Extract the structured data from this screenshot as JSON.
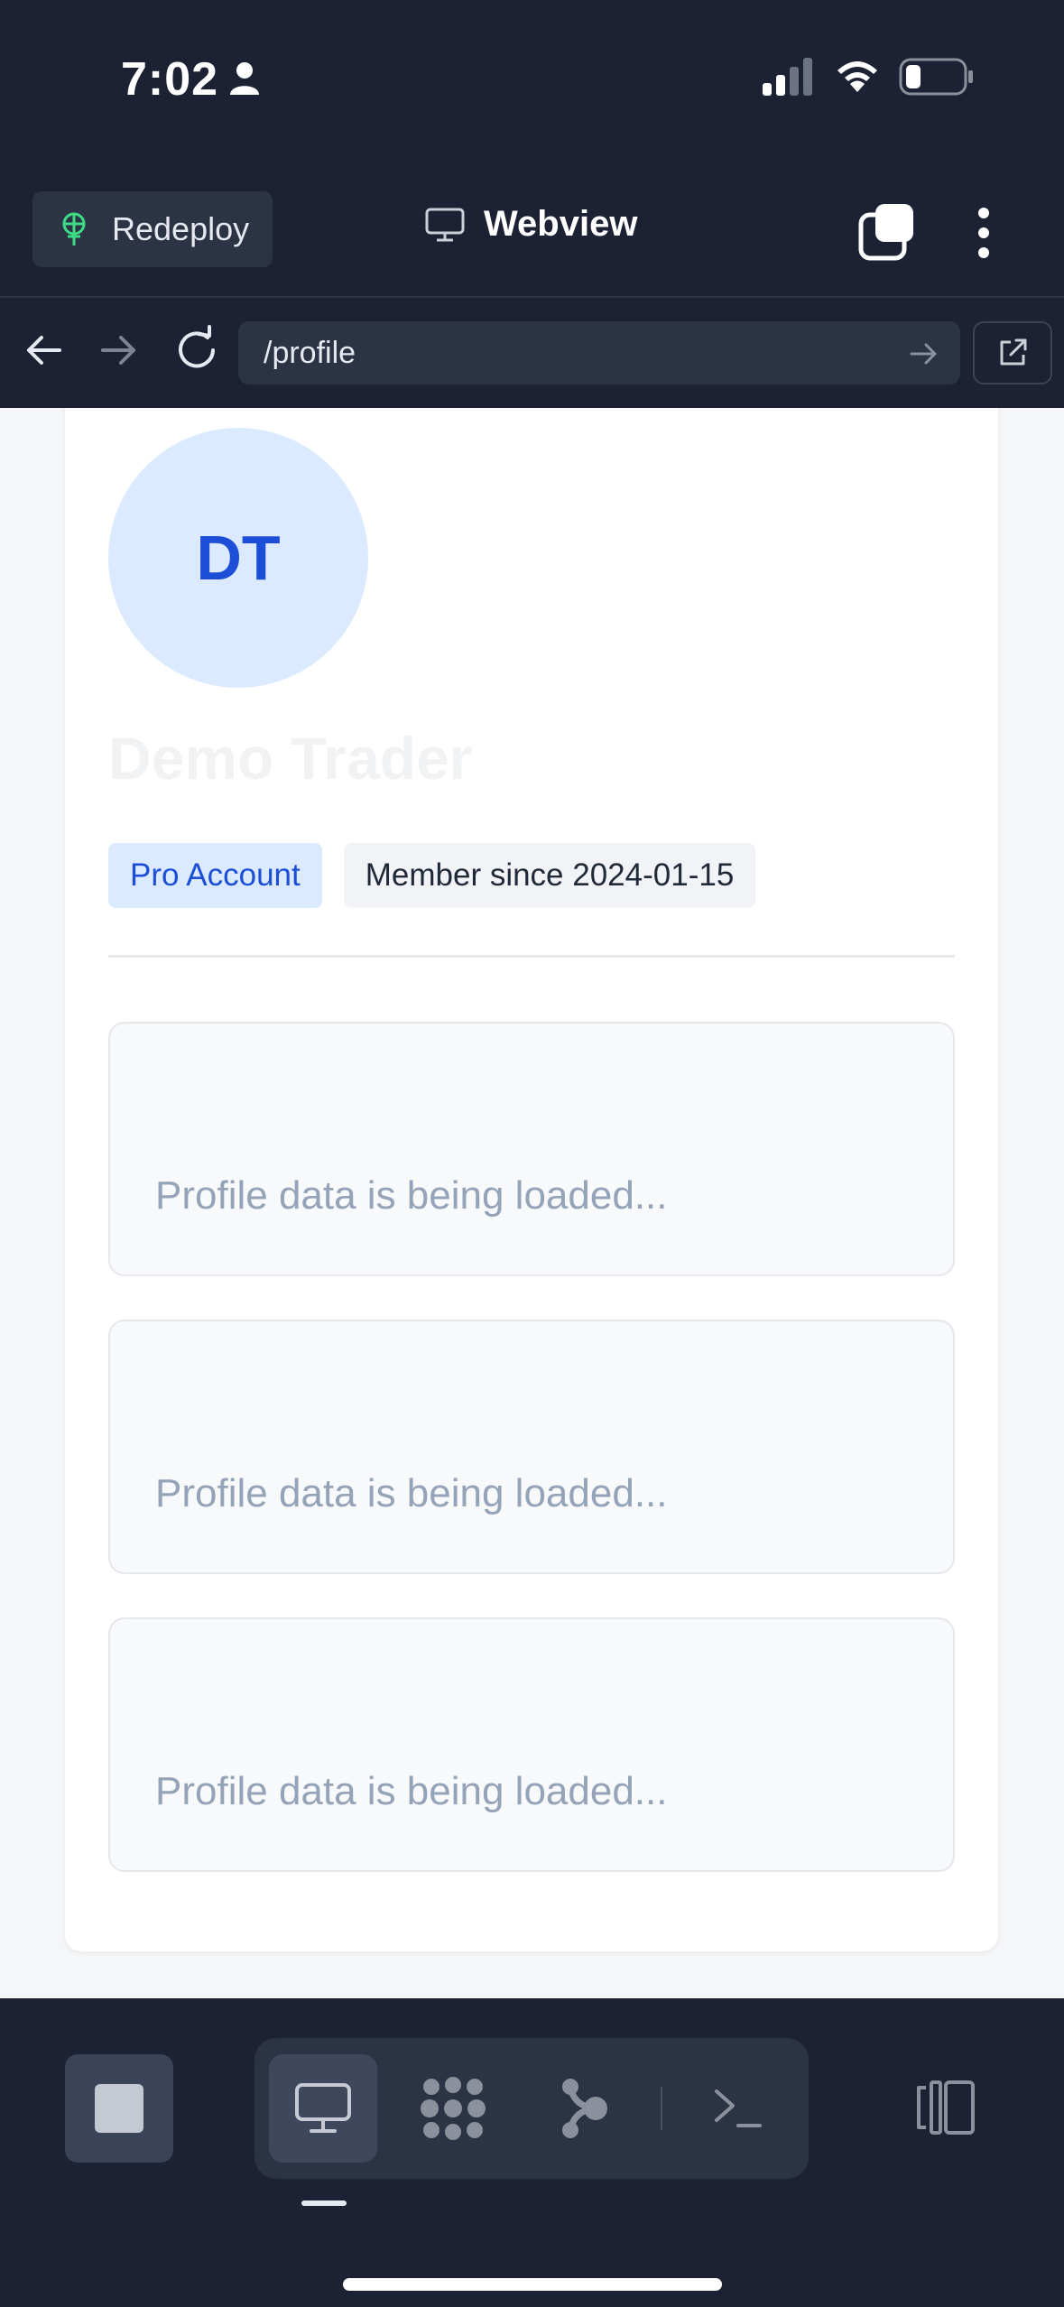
{
  "status_bar": {
    "time": "7:02"
  },
  "header": {
    "redeploy_label": "Redeploy",
    "title": "Webview"
  },
  "address_bar": {
    "url": "/profile"
  },
  "profile": {
    "avatar_initials": "DT",
    "name": "Demo Trader",
    "badges": {
      "plan": "Pro Account",
      "member_since": "Member since 2024-01-15"
    },
    "loading_sections": [
      {
        "text": "Profile data is being loaded..."
      },
      {
        "text": "Profile data is being loaded..."
      },
      {
        "text": "Profile data is being loaded..."
      }
    ]
  },
  "toolbar": {
    "tools": [
      "webview-icon",
      "grid-dots-icon",
      "branch-icon",
      "terminal-icon"
    ],
    "active_tool": "webview"
  },
  "colors": {
    "app_bg": "#1c2233",
    "accent_blue": "#1d4ed8",
    "avatar_bg": "#dbeafe",
    "redeploy_icon_green": "#3ddc84"
  }
}
